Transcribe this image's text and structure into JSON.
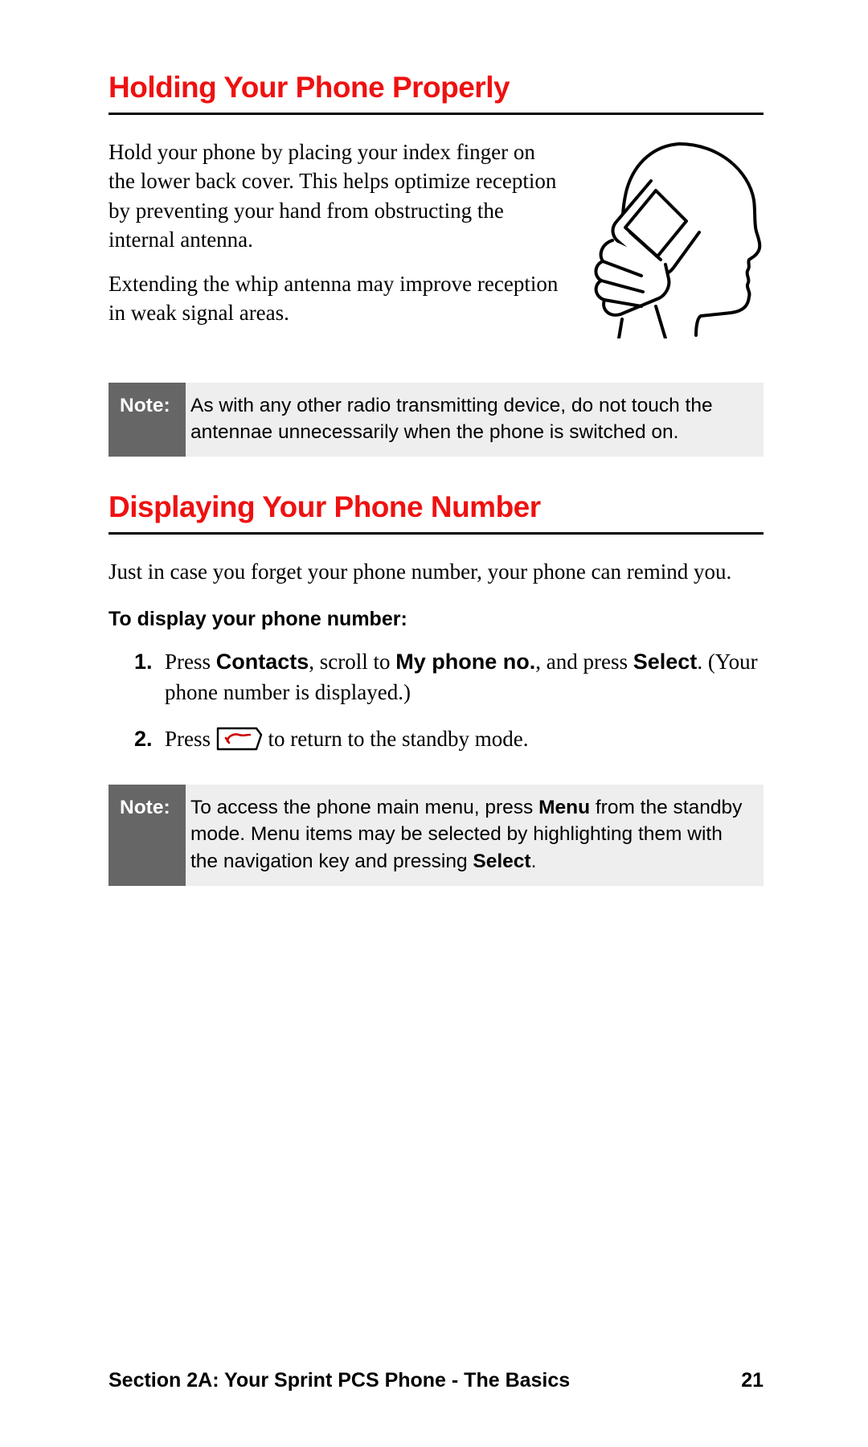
{
  "section1": {
    "heading": "Holding Your Phone Properly",
    "p1": "Hold your phone by placing your index finger on the lower back cover. This helps optimize reception by preventing your hand from obstructing the internal antenna.",
    "p2": "Extending the whip antenna may improve reception in weak signal areas."
  },
  "note1": {
    "label": "Note:",
    "text": "As with any other radio transmitting device, do not touch the antennae unnecessarily when the phone is switched on."
  },
  "section2": {
    "heading": "Displaying Your Phone Number",
    "intro": "Just in case you forget your phone number, your phone can remind you.",
    "subhead": "To display your phone number:",
    "step1": {
      "pre": "Press ",
      "b1": "Contacts",
      "mid1": ", scroll to ",
      "b2": "My phone no.",
      "mid2": ", and press ",
      "b3": "Select",
      "post": ". (Your phone number is displayed.)"
    },
    "step2": {
      "pre": "Press ",
      "post": " to return to the standby mode."
    }
  },
  "note2": {
    "label": "Note:",
    "pre": "To access the phone main menu, press ",
    "b1": "Menu",
    "mid": " from the standby mode. Menu items may be selected by highlighting them with the navigation key and pressing ",
    "b2": "Select",
    "post": "."
  },
  "footer": {
    "section": "Section 2A: Your Sprint PCS Phone - The Basics",
    "page": "21"
  }
}
